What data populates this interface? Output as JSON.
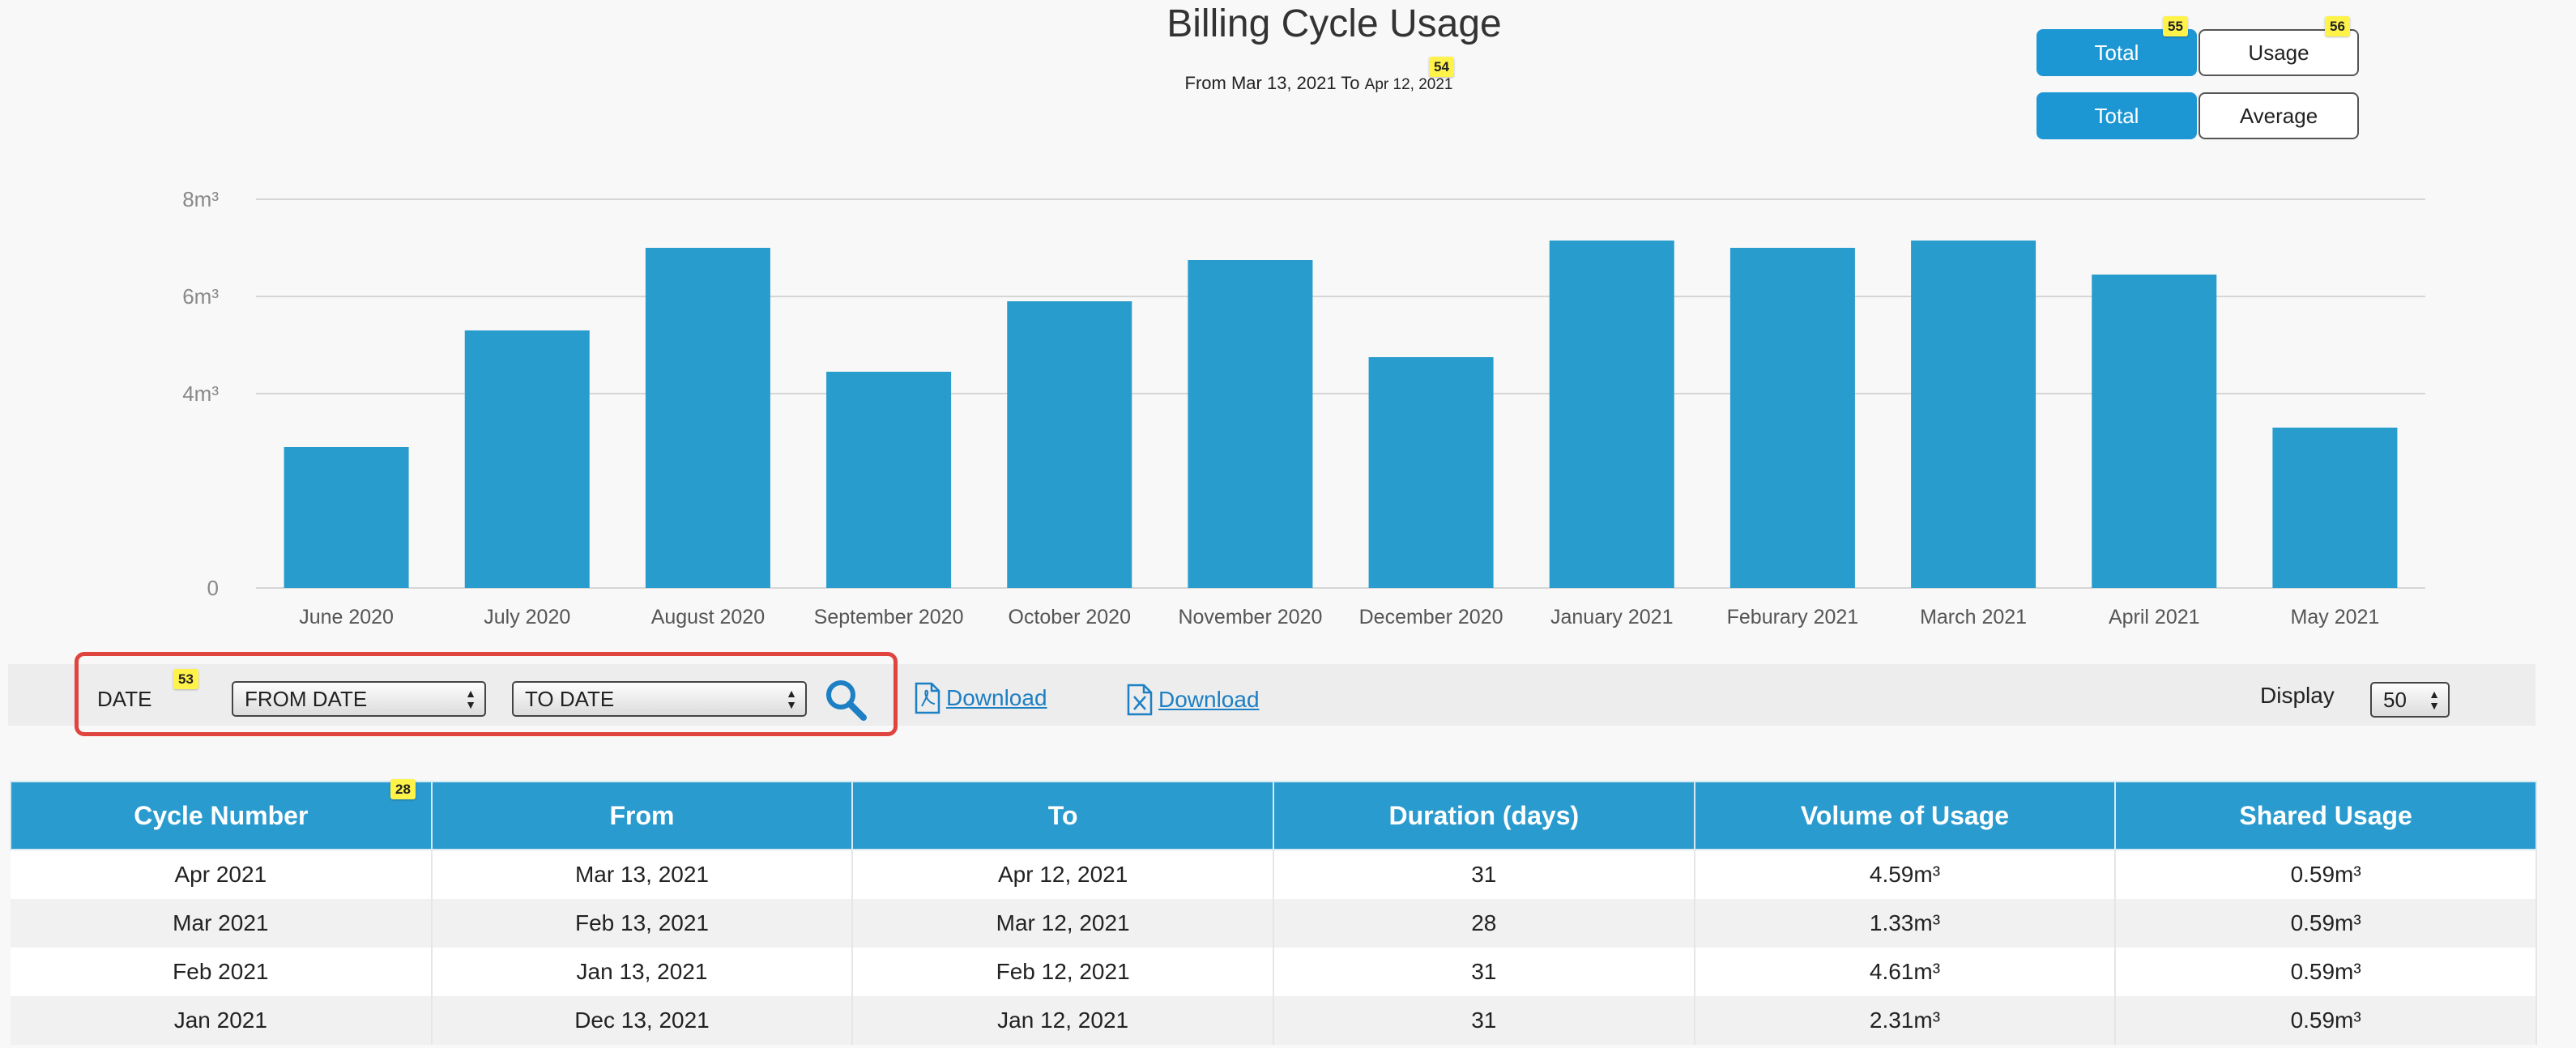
{
  "header": {
    "title": "Billing Cycle Usage",
    "subtitle_from": "From Mar 13, 2021 To",
    "subtitle_to": "Apr 12, 2021"
  },
  "toggles": {
    "row1": {
      "total": "Total",
      "usage": "Usage"
    },
    "row2": {
      "total": "Total",
      "average": "Average"
    }
  },
  "badges": {
    "b53": "53",
    "b54": "54",
    "b55": "55",
    "b56": "56",
    "b28": "28"
  },
  "chart_data": {
    "type": "bar",
    "categories": [
      "June 2020",
      "July 2020",
      "August 2020",
      "September 2020",
      "October 2020",
      "November 2020",
      "December 2020",
      "January 2021",
      "Feburary 2021",
      "March 2021",
      "April 2021",
      "May 2021"
    ],
    "values": [
      2.9,
      5.3,
      7.0,
      4.45,
      5.9,
      6.75,
      4.75,
      7.15,
      7.0,
      7.15,
      6.45,
      3.3
    ],
    "ylim": [
      0,
      8
    ],
    "y_ticks": [
      {
        "value": 0,
        "label": "0"
      },
      {
        "value": 4,
        "label": "4m³"
      },
      {
        "value": 6,
        "label": "6m³"
      },
      {
        "value": 8,
        "label": "8m³"
      }
    ],
    "bar_color": "#289ccd",
    "grid": true
  },
  "filter": {
    "date_label": "DATE",
    "from_date": "FROM DATE",
    "to_date": "TO DATE",
    "download_pdf": "Download",
    "download_xls": "Download",
    "display_label": "Display",
    "display_value": "50"
  },
  "table": {
    "headers": [
      "Cycle Number",
      "From",
      "To",
      "Duration (days)",
      "Volume of Usage",
      "Shared Usage"
    ],
    "rows": [
      [
        "Apr 2021",
        "Mar 13, 2021",
        "Apr 12, 2021",
        "31",
        "4.59m³",
        "0.59m³"
      ],
      [
        "Mar 2021",
        "Feb 13, 2021",
        "Mar 12, 2021",
        "28",
        "1.33m³",
        "0.59m³"
      ],
      [
        "Feb 2021",
        "Jan 13, 2021",
        "Feb 12, 2021",
        "31",
        "4.61m³",
        "0.59m³"
      ],
      [
        "Jan 2021",
        "Dec 13, 2021",
        "Jan 12, 2021",
        "31",
        "2.31m³",
        "0.59m³"
      ]
    ]
  },
  "colors": {
    "accent": "#1d97d4",
    "highlight": "#e0443f",
    "header_bg": "#2a9bce"
  }
}
